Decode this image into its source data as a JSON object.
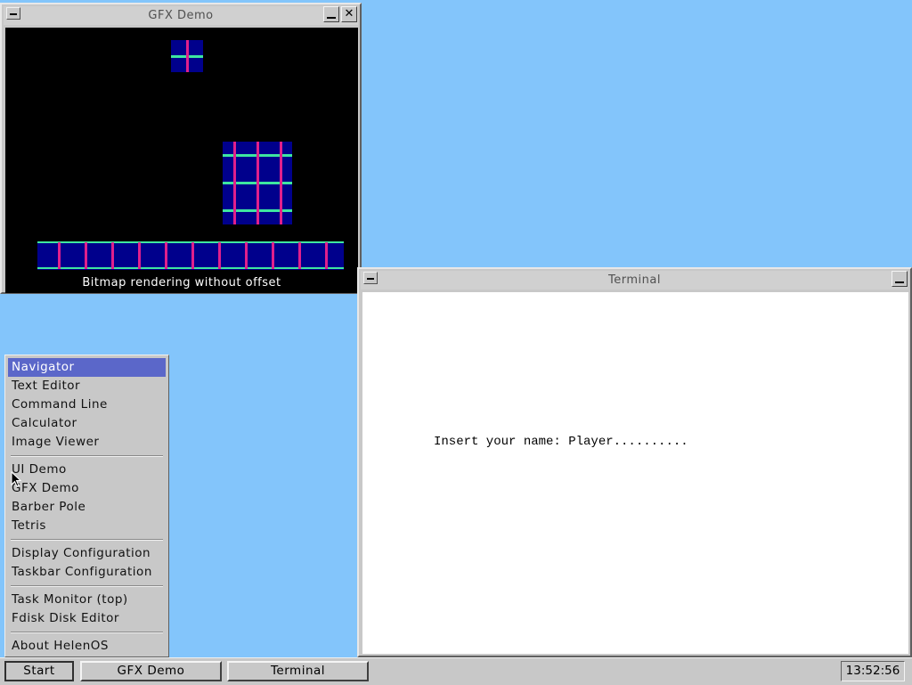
{
  "desktop": {
    "background": "#83c5fb"
  },
  "gfx_window": {
    "title": "GFX Demo",
    "minimize_icon": "minimize-icon",
    "close_icon": "close-icon",
    "caption": "Bitmap rendering without offset"
  },
  "terminal_window": {
    "title": "Terminal",
    "prompt_text": "Insert your name: Player.........."
  },
  "start_menu": {
    "groups": [
      [
        "Navigator",
        "Text Editor",
        "Command Line",
        "Calculator",
        "Image Viewer"
      ],
      [
        "UI Demo",
        "GFX Demo",
        "Barber Pole",
        "Tetris"
      ],
      [
        "Display Configuration",
        "Taskbar Configuration"
      ],
      [
        "Task Monitor (top)",
        "Fdisk Disk Editor"
      ],
      [
        "About HelenOS"
      ]
    ],
    "selected": "Navigator"
  },
  "taskbar": {
    "start_label": "Start",
    "windows": [
      "GFX Demo",
      "Terminal"
    ],
    "clock": "13:52:56"
  },
  "colors": {
    "menu_highlight": "#5b67c9",
    "bitmap_fill": "#00008c",
    "bitmap_line_h": "#3ee6a0",
    "bitmap_line_v": "#e0208c"
  }
}
